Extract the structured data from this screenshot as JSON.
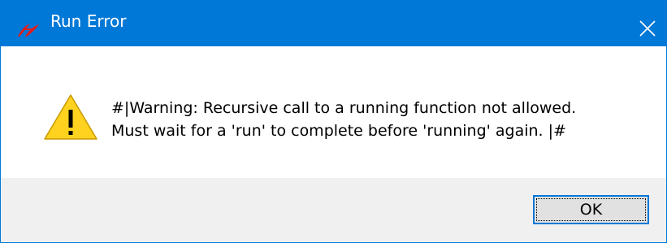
{
  "window": {
    "title": "Run Error",
    "app_icon": "tk-feather-icon",
    "accent_color": "#0078d7"
  },
  "titlebar": {
    "close_icon": "close-icon"
  },
  "message": {
    "icon": "warning-icon",
    "line1": "#|Warning: Recursive call to a running function not allowed.",
    "line2": "Must wait for a 'run' to complete before 'running' again. |#"
  },
  "buttons": {
    "ok_label": "OK"
  }
}
